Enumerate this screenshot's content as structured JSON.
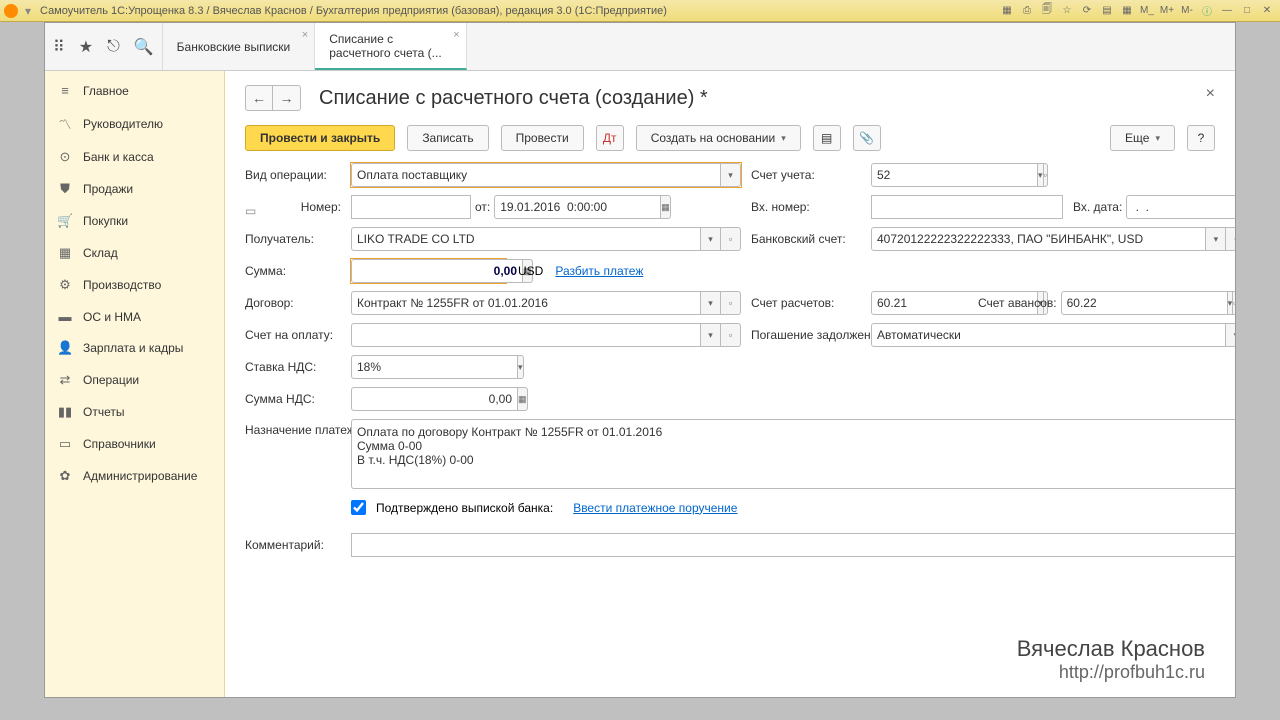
{
  "window_title": "Самоучитель 1С:Упрощенка 8.3 / Вячеслав Краснов / Бухгалтерия предприятия (базовая), редакция 3.0  (1С:Предприятие)",
  "tabs": {
    "t1": "Банковские выписки",
    "t2a": "Списание с",
    "t2b": "расчетного счета (..."
  },
  "sidebar": [
    "Главное",
    "Руководителю",
    "Банк и касса",
    "Продажи",
    "Покупки",
    "Склад",
    "Производство",
    "ОС и НМА",
    "Зарплата и кадры",
    "Операции",
    "Отчеты",
    "Справочники",
    "Администрирование"
  ],
  "heading": "Списание с расчетного счета (создание) *",
  "toolbar": {
    "post_close": "Провести и закрыть",
    "save": "Записать",
    "post": "Провести",
    "create_based": "Создать на основании",
    "more": "Еще"
  },
  "labels": {
    "op_type": "Вид операции:",
    "account": "Счет учета:",
    "number": "Номер:",
    "from": "от:",
    "in_number": "Вх. номер:",
    "in_date": "Вх. дата:",
    "recipient": "Получатель:",
    "bank_account": "Банковский счет:",
    "amount": "Сумма:",
    "currency": "USD",
    "split": "Разбить платеж",
    "contract": "Договор:",
    "settle_acc": "Счет расчетов:",
    "advance_acc": "Счет авансов:",
    "invoice": "Счет на оплату:",
    "debt": "Погашение задолженности:",
    "vat_rate": "Ставка НДС:",
    "vat_amount": "Сумма НДС:",
    "purpose": "Назначение платежа:",
    "confirmed": "Подтверждено выпиской банка:",
    "enter_order": "Ввести платежное поручение",
    "comment": "Комментарий:"
  },
  "values": {
    "op_type": "Оплата поставщику",
    "account": "52",
    "date": "19.01.2016  0:00:00",
    "in_date": " .  .    ",
    "recipient": "LIKO TRADE CO LTD",
    "bank_account": "40720122222322222333, ПАО \"БИНБАНК\", USD",
    "amount": "0,00",
    "contract": "Контракт № 1255FR от 01.01.2016",
    "settle_acc": "60.21",
    "advance_acc": "60.22",
    "debt": "Автоматически",
    "vat_rate": "18%",
    "vat_amount": "0,00",
    "purpose": "Оплата по договору Контракт № 1255FR от 01.01.2016\nСумма 0-00\nВ т.ч. НДС(18%) 0-00"
  },
  "watermark": {
    "name": "Вячеслав Краснов",
    "url": "http://profbuh1c.ru"
  }
}
